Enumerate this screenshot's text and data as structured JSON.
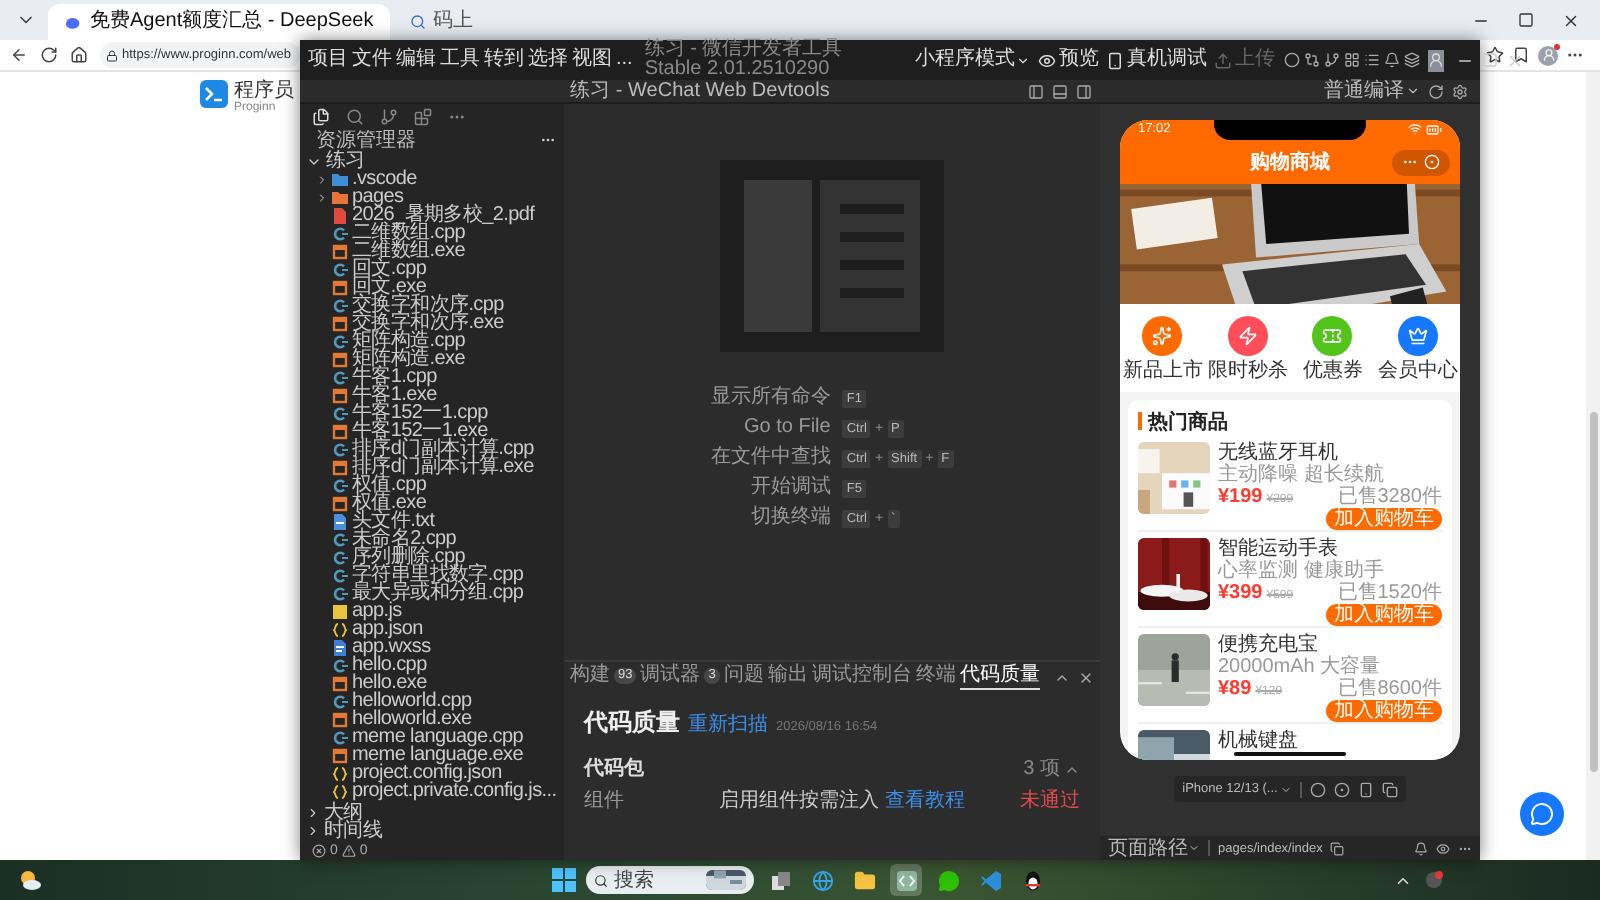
{
  "browser": {
    "tabs": [
      {
        "title": "免费Agent额度汇总 - DeepSeek",
        "selected": true
      },
      {
        "title": "码上",
        "selected": false
      }
    ],
    "url": "https://www.proginn.com/web",
    "site": {
      "name": "程序员",
      "subtitle": "Proginn"
    }
  },
  "devtools": {
    "menu": [
      "项目",
      "文件",
      "编辑",
      "工具",
      "转到",
      "选择",
      "视图",
      "..."
    ],
    "title": "练习 - 微信开发者工具 Stable 2.01.2510290",
    "toolbar": [
      {
        "label": "小程序模式",
        "kind": "mode",
        "disabled": false
      },
      {
        "label": "预览",
        "kind": "preview",
        "disabled": false
      },
      {
        "label": "真机调试",
        "kind": "debug",
        "disabled": false
      },
      {
        "label": "上传",
        "kind": "upload",
        "disabled": true
      }
    ],
    "subtitle": "练习 - WeChat Web Devtools",
    "compile": "普通编译",
    "explorer": {
      "title": "资源管理器",
      "root": {
        "name": "练习",
        "expanded": true,
        "children": [
          {
            "name": ".vscode",
            "kind": "folder",
            "expanded": false,
            "color": "#3f8fd8"
          },
          {
            "name": "pages",
            "kind": "folder",
            "expanded": false,
            "color": "#e8743b"
          },
          {
            "name": "2026_暑期多校_2.pdf",
            "kind": "pdf"
          },
          {
            "name": "二维数组.cpp",
            "kind": "cpp"
          },
          {
            "name": "二维数组.exe",
            "kind": "exe"
          },
          {
            "name": "回文.cpp",
            "kind": "cpp"
          },
          {
            "name": "回文.exe",
            "kind": "exe"
          },
          {
            "name": "交换字和次序.cpp",
            "kind": "cpp"
          },
          {
            "name": "交换字和次序.exe",
            "kind": "exe"
          },
          {
            "name": "矩阵构造.cpp",
            "kind": "cpp"
          },
          {
            "name": "矩阵构造.exe",
            "kind": "exe"
          },
          {
            "name": "牛客1.cpp",
            "kind": "cpp"
          },
          {
            "name": "牛客1.exe",
            "kind": "exe"
          },
          {
            "name": "牛客152一1.cpp",
            "kind": "cpp"
          },
          {
            "name": "牛客152一1.exe",
            "kind": "exe"
          },
          {
            "name": "排序d门副本计算.cpp",
            "kind": "cpp"
          },
          {
            "name": "排序d门副本计算.exe",
            "kind": "exe"
          },
          {
            "name": "权值.cpp",
            "kind": "cpp"
          },
          {
            "name": "权值.exe",
            "kind": "exe"
          },
          {
            "name": "头文件.txt",
            "kind": "txt"
          },
          {
            "name": "未命名2.cpp",
            "kind": "cpp"
          },
          {
            "name": "序列删除.cpp",
            "kind": "cpp"
          },
          {
            "name": "字符串里找数字.cpp",
            "kind": "cpp"
          },
          {
            "name": "最大异或和分组.cpp",
            "kind": "cpp"
          },
          {
            "name": "app.js",
            "kind": "js"
          },
          {
            "name": "app.json",
            "kind": "json"
          },
          {
            "name": "app.wxss",
            "kind": "wxss"
          },
          {
            "name": "hello.cpp",
            "kind": "cpp"
          },
          {
            "name": "hello.exe",
            "kind": "exe"
          },
          {
            "name": "helloworld.cpp",
            "kind": "cpp"
          },
          {
            "name": "helloworld.exe",
            "kind": "exe"
          },
          {
            "name": "meme language.cpp",
            "kind": "cpp"
          },
          {
            "name": "meme language.exe",
            "kind": "exe"
          },
          {
            "name": "project.config.json",
            "kind": "json"
          },
          {
            "name": "project.private.config.js...",
            "kind": "json"
          }
        ]
      },
      "sections": [
        {
          "label": "大纲",
          "expanded": false
        },
        {
          "label": "时间线",
          "expanded": false
        }
      ],
      "errors": "0",
      "warnings": "0"
    },
    "shortcuts": [
      {
        "label": "显示所有命令",
        "keys": [
          {
            "kind": "key",
            "text": "F1"
          }
        ]
      },
      {
        "label": "Go to File",
        "keys": [
          {
            "kind": "key",
            "text": "Ctrl"
          },
          {
            "kind": "plus",
            "text": "+"
          },
          {
            "kind": "key",
            "text": "P"
          }
        ]
      },
      {
        "label": "在文件中查找",
        "keys": [
          {
            "kind": "key",
            "text": "Ctrl"
          },
          {
            "kind": "plus",
            "text": "+"
          },
          {
            "kind": "key",
            "text": "Shift"
          },
          {
            "kind": "plus",
            "text": "+"
          },
          {
            "kind": "key",
            "text": "F"
          }
        ]
      },
      {
        "label": "开始调试",
        "keys": [
          {
            "kind": "key",
            "text": "F5"
          }
        ]
      },
      {
        "label": "切换终端",
        "keys": [
          {
            "kind": "key",
            "text": "Ctrl"
          },
          {
            "kind": "plus",
            "text": "+"
          },
          {
            "kind": "key",
            "text": "`"
          }
        ]
      }
    ],
    "panel": {
      "tabs": [
        {
          "label": "构建",
          "badge": "93",
          "selected": false
        },
        {
          "label": "调试器",
          "badge": "3",
          "selected": false
        },
        {
          "label": "问题",
          "selected": false
        },
        {
          "label": "输出",
          "selected": false
        },
        {
          "label": "调试控制台",
          "selected": false
        },
        {
          "label": "终端",
          "selected": false
        },
        {
          "label": "代码质量",
          "selected": true
        }
      ],
      "title": "代码质量",
      "rescan": "重新扫描",
      "time": "2026/08/16 16:54",
      "group": {
        "label": "代码包",
        "count": "3 项",
        "expanded": true
      },
      "rows": [
        {
          "label": "组件",
          "text": "启用组件按需注入 ",
          "link": "查看教程",
          "status": "未通过"
        }
      ]
    },
    "device": "iPhone 12/13 (...",
    "path_label": "页面路径",
    "path": "pages/index/index"
  },
  "phone": {
    "time": "17:02",
    "title": "购物商城",
    "categories": [
      {
        "label": "新品上市",
        "kind": "new",
        "color": "#ff6a00"
      },
      {
        "label": "限时秒杀",
        "kind": "flash",
        "color": "#ff4d5a"
      },
      {
        "label": "优惠券",
        "kind": "coupon",
        "color": "#52c41a"
      },
      {
        "label": "会员中心",
        "kind": "member",
        "color": "#1677ff"
      }
    ],
    "section": "热门商品",
    "products": [
      {
        "name": "无线蓝牙耳机",
        "desc": "主动降噪 超长续航",
        "price": "¥199",
        "old_price": "¥299",
        "sold": "已售3280件",
        "button": "加入购物车"
      },
      {
        "name": "智能运动手表",
        "desc": "心率监测 健康助手",
        "price": "¥399",
        "old_price": "¥599",
        "sold": "已售1520件",
        "button": "加入购物车"
      },
      {
        "name": "便携充电宝",
        "desc": "20000mAh 大容量",
        "price": "¥89",
        "old_price": "¥129",
        "sold": "已售8600件",
        "button": "加入购物车"
      },
      {
        "name": "机械键盘"
      }
    ]
  },
  "taskbar": {
    "search": "搜索",
    "apps": [
      {
        "kind": "taskview",
        "selected": false
      },
      {
        "kind": "browser",
        "selected": false
      },
      {
        "kind": "files",
        "selected": false
      },
      {
        "kind": "devtools",
        "selected": true
      },
      {
        "kind": "chat",
        "selected": false
      },
      {
        "kind": "editor",
        "selected": false
      },
      {
        "kind": "penguin",
        "selected": false
      }
    ]
  }
}
